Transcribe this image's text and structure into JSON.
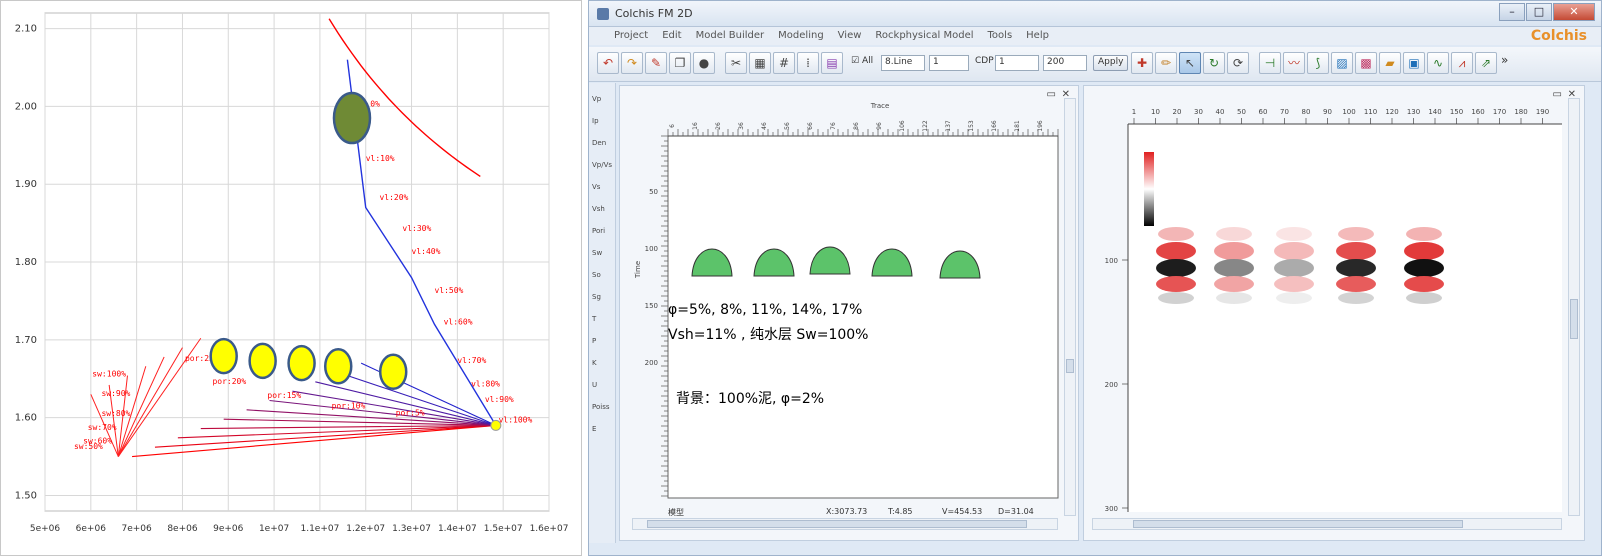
{
  "crossplot": {
    "yticks": [
      "2.10",
      "2.00",
      "1.90",
      "1.80",
      "1.70",
      "1.60",
      "1.50"
    ],
    "xticks": [
      "5e+06",
      "6e+06",
      "7e+06",
      "8e+06",
      "9e+06",
      "1e+07",
      "1.1e+07",
      "1.2e+07",
      "1.3e+07",
      "1.4e+07",
      "1.5e+07",
      "1.6e+07"
    ],
    "vl_labels": [
      "0%",
      "vl:10%",
      "vl:20%",
      "vl:30%",
      "vl:40%",
      "vl:50%",
      "vl:60%",
      "vl:70%",
      "vl:80%",
      "vl:90%",
      "vl:100%"
    ],
    "sw_labels": [
      "sw:100%",
      "sw:90%",
      "sw:80%",
      "sw:70%",
      "sw:60%",
      "sw:50%"
    ],
    "por_labels": [
      "por:25%",
      "por:20%",
      "por:15%",
      "por:10%",
      "por:5%"
    ],
    "colors": {
      "low": "#ff0000",
      "high": "#2222cc",
      "marker_green": "#6f8a35",
      "marker_yellow": "#ffff00",
      "marker_edge": "#3a5a8a",
      "label": "#ff0000"
    }
  },
  "app": {
    "title": "Colchis FM 2D",
    "brand": "Colchis",
    "menu": [
      "Project",
      "Edit",
      "Model Builder",
      "Modeling",
      "View",
      "Rockphysical Model",
      "Tools",
      "Help"
    ],
    "toolbar": {
      "all_label": "All",
      "mode_value": "8.Line",
      "line_value": "1",
      "cdp_label": "CDP",
      "cdp_value": "1",
      "cdp_end": "200",
      "apply_label": "Apply"
    },
    "sidebar": [
      "Vp",
      "Ip",
      "Den",
      "Vp/Vs",
      "Vs",
      "Vsh",
      "Pori",
      "Sw",
      "So",
      "Sg",
      "T",
      "P",
      "K",
      "U",
      "Poiss",
      "E"
    ],
    "model_pane": {
      "top_axis_label": "Trace",
      "top_ticks": [
        "6",
        "16",
        "26",
        "36",
        "46",
        "56",
        "66",
        "76",
        "86",
        "96",
        "106",
        "122",
        "137",
        "153",
        "166",
        "181",
        "196"
      ],
      "left_axis_label": "Time",
      "left_ticks": [
        "50",
        "100",
        "150",
        "200"
      ],
      "annotation_line1": "φ=5%, 8%, 11%, 14%, 17%",
      "annotation_line2": "Vsh=11% , 纯水层 Sw=100%",
      "annotation_line3": "背景：100%泥, φ=2%",
      "status_left": "模型",
      "status_x": "X:3073.73",
      "status_t": "T:4.85",
      "status_v": "V=454.53",
      "status_d": "D=31.04",
      "shape_color": "#5cc36a"
    },
    "seismic_pane": {
      "top_ticks": [
        "1",
        "10",
        "20",
        "30",
        "40",
        "50",
        "60",
        "70",
        "80",
        "90",
        "100",
        "110",
        "120",
        "130",
        "140",
        "150",
        "160",
        "170",
        "180",
        "190"
      ],
      "left_ticks": [
        "100",
        "200",
        "300"
      ]
    }
  }
}
